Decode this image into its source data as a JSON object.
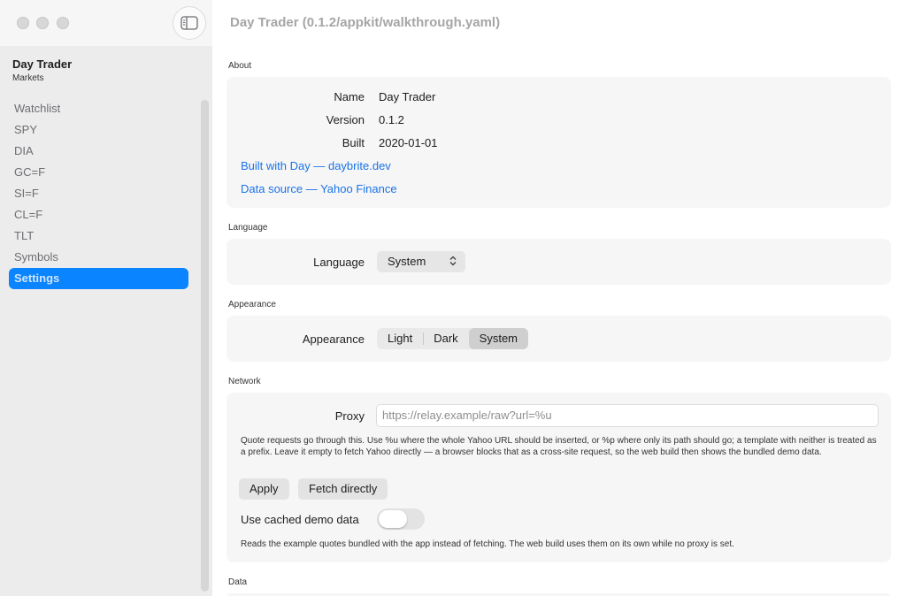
{
  "window": {
    "title": "Day Trader (0.1.2/appkit/walkthrough.yaml)"
  },
  "sidebar": {
    "title": "Day Trader",
    "subtitle": "Markets",
    "items": [
      {
        "label": "Watchlist"
      },
      {
        "label": "SPY"
      },
      {
        "label": "DIA"
      },
      {
        "label": "GC=F"
      },
      {
        "label": "SI=F"
      },
      {
        "label": "CL=F"
      },
      {
        "label": "TLT"
      },
      {
        "label": "Symbols"
      },
      {
        "label": "Settings",
        "selected": true
      }
    ]
  },
  "about": {
    "section_label": "About",
    "name_label": "Name",
    "name_value": "Day Trader",
    "version_label": "Version",
    "version_value": "0.1.2",
    "built_label": "Built",
    "built_value": "2020-01-01",
    "built_with_link": "Built with Day — daybrite.dev",
    "data_source_link": "Data source — Yahoo Finance"
  },
  "language": {
    "section_label": "Language",
    "row_label": "Language",
    "selected": "System",
    "chevron_glyph": "⌃⌄"
  },
  "appearance": {
    "section_label": "Appearance",
    "row_label": "Appearance",
    "options": [
      "Light",
      "Dark",
      "System"
    ],
    "selected": "System"
  },
  "network": {
    "section_label": "Network",
    "proxy_label": "Proxy",
    "proxy_placeholder": "https://relay.example/raw?url=%u",
    "proxy_help": "Quote requests go through this. Use %u where the whole Yahoo URL should be inserted, or %p where only its path should go; a template with neither is treated as a prefix. Leave it empty to fetch Yahoo directly — a browser blocks that as a cross-site request, so the web build then shows the bundled demo data.",
    "apply_label": "Apply",
    "fetch_directly_label": "Fetch directly",
    "cached_label": "Use cached demo data",
    "cached_enabled": false,
    "cached_help": "Reads the example quotes bundled with the app instead of fetching. The web build uses them on its own while no proxy is set."
  },
  "data": {
    "section_label": "Data"
  }
}
